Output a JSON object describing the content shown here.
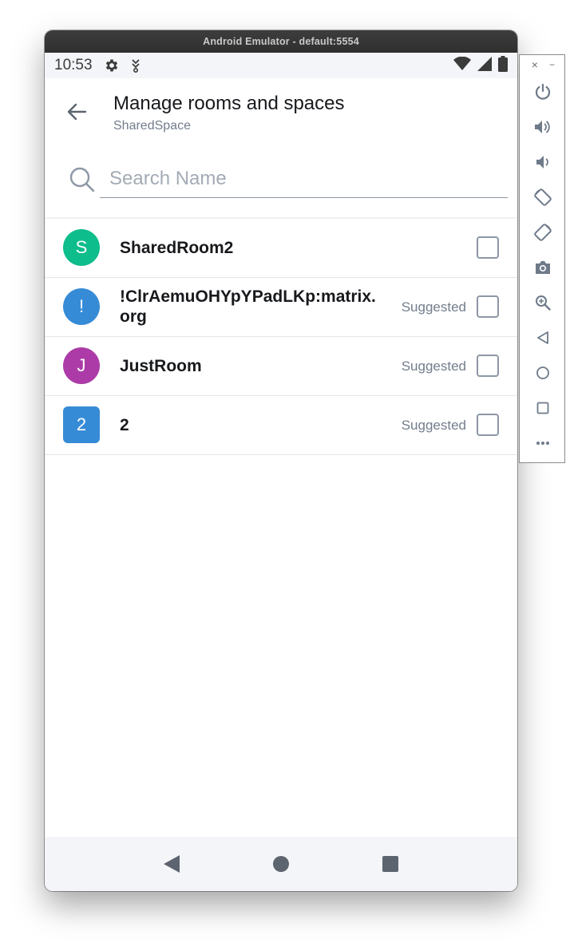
{
  "window": {
    "title": "Android Emulator - default:5554"
  },
  "status_bar": {
    "time": "10:53"
  },
  "header": {
    "title": "Manage rooms and spaces",
    "subtitle": "SharedSpace"
  },
  "search": {
    "placeholder": "Search Name",
    "value": ""
  },
  "rooms": [
    {
      "initial": "S",
      "name": "SharedRoom2",
      "suggested": "",
      "avatar_color": "#0dbd8b",
      "avatar_shape": "circle"
    },
    {
      "initial": "!",
      "name_line1": "!ClrAemuOHYpYPadLKp:matrix.",
      "name_line2": "org",
      "suggested": "Suggested",
      "avatar_color": "#368bd6",
      "avatar_shape": "circle"
    },
    {
      "initial": "J",
      "name": "JustRoom",
      "suggested": "Suggested",
      "avatar_color": "#ac3ba8",
      "avatar_shape": "circle"
    },
    {
      "initial": "2",
      "name": "2",
      "suggested": "Suggested",
      "avatar_color": "#368bd6",
      "avatar_shape": "square"
    }
  ],
  "toolbar": {
    "close": "×",
    "minimize": "−",
    "buttons": [
      "power-icon",
      "volume-up-icon",
      "volume-down-icon",
      "rotate-left-icon",
      "rotate-right-icon",
      "camera-icon",
      "zoom-icon",
      "back-icon",
      "home-icon",
      "overview-icon",
      "more-icon"
    ]
  },
  "colors": {
    "accent": "#0dbd8b",
    "text_primary": "#17191c",
    "text_secondary": "#737d8c"
  }
}
